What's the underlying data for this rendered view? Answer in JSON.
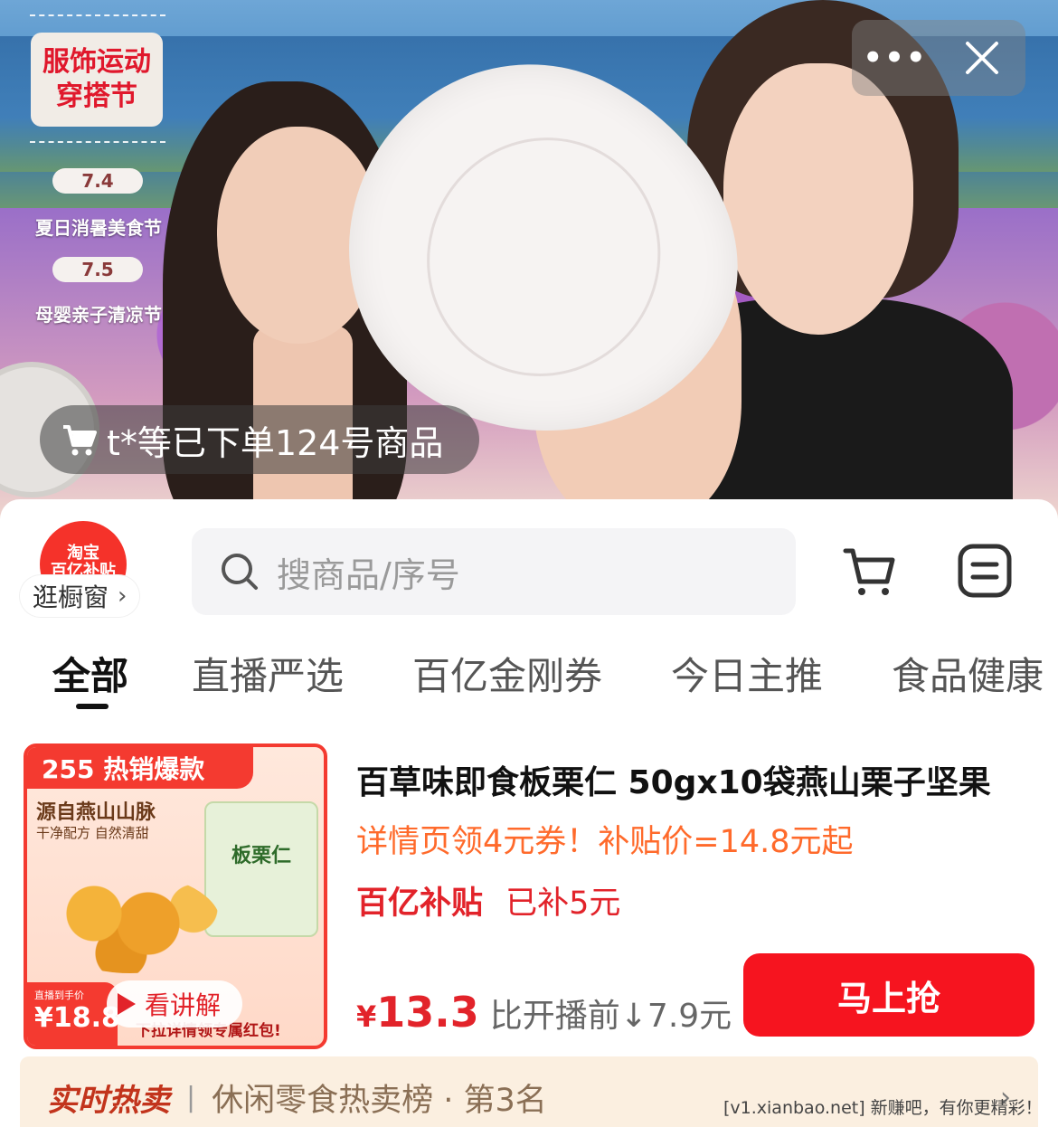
{
  "live": {
    "event_badge": "服饰运动\n穿搭节",
    "events": [
      {
        "date": "7.4",
        "name": "夏日消暑美食节"
      },
      {
        "date": "7.5",
        "name": "母婴亲子清凉节"
      }
    ],
    "order_notice": "t*等已下单124号商品"
  },
  "controls": {
    "more_icon": "more-dots-icon",
    "close_icon": "close-icon"
  },
  "store": {
    "logo_text": "淘宝\n百亿补贴",
    "browse_label": "逛橱窗",
    "browse_chevron": "›"
  },
  "search": {
    "placeholder": "搜商品/序号"
  },
  "tabs": [
    "全部",
    "直播严选",
    "百亿金刚券",
    "今日主推",
    "食品健康"
  ],
  "product": {
    "hot_label": "255 热销爆款",
    "thumb_origin": "源自燕山山脉",
    "thumb_origin_sub": "干净配方 自然清甜",
    "thumb_pack": "板栗仁",
    "thumb_price_label": "直播到手价",
    "thumb_price": "¥18.8",
    "thumb_promo": "下拉详情领专属红包!",
    "explain_label": "看讲解",
    "title": "百草味即食板栗仁 50gx10袋燕山栗子坚果",
    "coupon": "详情页领4元券！补贴价=14.8元起",
    "subsidy_tag": "百亿补贴",
    "subsidy_amount": "已补5元",
    "currency": "¥",
    "price": "13.3",
    "price_drop": "比开播前↓7.9元",
    "buy_label": "马上抢"
  },
  "hot_strip": {
    "label": "实时热卖",
    "separator": "|",
    "rank": "休闲零食热卖榜 · 第3名",
    "arrow": "›"
  },
  "watermark": "[v1.xianbao.net] 新赚吧，有你更精彩！",
  "colors": {
    "brand_red": "#f6141f",
    "coupon_orange": "#ff6a2b",
    "strip_bg": "#fbefe0"
  }
}
